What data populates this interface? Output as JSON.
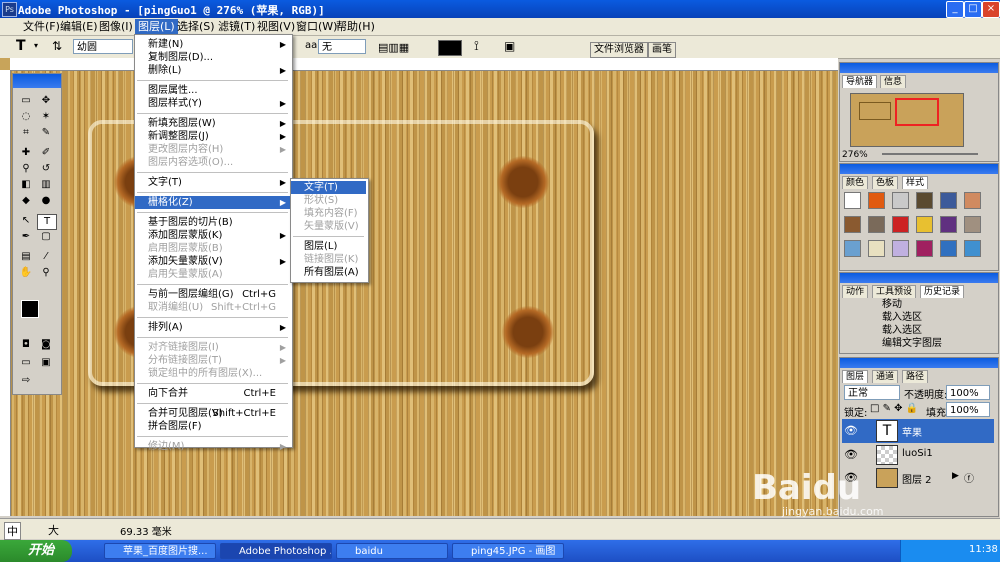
{
  "window": {
    "title": "Adobe Photoshop - [pingGuo1 @ 276% (苹果, RGB)]"
  },
  "menubar": [
    "文件(F)",
    "编辑(E)",
    "图像(I)",
    "图层(L)",
    "选择(S)",
    "滤镜(T)",
    "视图(V)",
    "窗口(W)",
    "帮助(H)"
  ],
  "options": {
    "font_family": "幼圆",
    "aa_label": "aa",
    "aa_value": "无",
    "tab_file_browser": "文件浏览器",
    "tab_brushes": "画笔"
  },
  "layer_menu": [
    {
      "label": "新建(N)",
      "arrow": true
    },
    {
      "label": "复制图层(D)..."
    },
    {
      "label": "删除(L)",
      "arrow": true
    },
    {
      "label": "图层属性..."
    },
    {
      "label": "图层样式(Y)",
      "arrow": true
    },
    {
      "label": "新填充图层(W)",
      "arrow": true
    },
    {
      "label": "新调整图层(J)",
      "arrow": true
    },
    {
      "label": "更改图层内容(H)",
      "arrow": true,
      "disabled": true
    },
    {
      "label": "图层内容选项(O)...",
      "disabled": true
    },
    {
      "label": "文字(T)",
      "arrow": true
    },
    {
      "label": "栅格化(Z)",
      "arrow": true,
      "highlight": true
    },
    {
      "label": "基于图层的切片(B)"
    },
    {
      "label": "添加图层蒙版(K)",
      "arrow": true
    },
    {
      "label": "启用图层蒙版(B)",
      "disabled": true
    },
    {
      "label": "添加矢量蒙版(V)",
      "arrow": true
    },
    {
      "label": "启用矢量蒙版(A)",
      "disabled": true
    },
    {
      "label": "与前一图层编组(G)",
      "shortcut": "Ctrl+G"
    },
    {
      "label": "取消编组(U)",
      "shortcut": "Shift+Ctrl+G",
      "disabled": true
    },
    {
      "label": "排列(A)",
      "arrow": true
    },
    {
      "label": "对齐链接图层(I)",
      "arrow": true,
      "disabled": true
    },
    {
      "label": "分布链接图层(T)",
      "arrow": true,
      "disabled": true
    },
    {
      "label": "锁定组中的所有图层(X)...",
      "disabled": true
    },
    {
      "label": "向下合并",
      "shortcut": "Ctrl+E"
    },
    {
      "label": "合并可见图层(V)",
      "shortcut": "Shift+Ctrl+E"
    },
    {
      "label": "拼合图层(F)"
    },
    {
      "label": "修边(M)",
      "arrow": true,
      "disabled": true
    }
  ],
  "rasterize_submenu": [
    {
      "label": "文字(T)",
      "highlight": true
    },
    {
      "label": "形状(S)",
      "disabled": true
    },
    {
      "label": "填充内容(F)",
      "disabled": true
    },
    {
      "label": "矢量蒙版(V)",
      "disabled": true
    },
    {
      "label": "图层(L)"
    },
    {
      "label": "链接图层(K)",
      "disabled": true
    },
    {
      "label": "所有图层(A)"
    }
  ],
  "navigator": {
    "tabs": [
      "导航器",
      "信息"
    ],
    "zoom": "276%"
  },
  "styles_panel": {
    "tabs": [
      "颜色",
      "色板",
      "样式"
    ]
  },
  "history_panel": {
    "tabs": [
      "动作",
      "工具预设",
      "历史记录"
    ],
    "items": [
      "移动",
      "载入选区",
      "载入选区",
      "编辑文字图层"
    ]
  },
  "layers_panel": {
    "tabs": [
      "图层",
      "通道",
      "路径"
    ],
    "blend_mode": "正常",
    "opacity_label": "不透明度:",
    "opacity": "100%",
    "lock_label": "锁定:",
    "fill_label": "填充:",
    "fill": "100%",
    "layers": [
      {
        "name": "苹果",
        "type": "text"
      },
      {
        "name": "luoSi1",
        "type": "normal"
      },
      {
        "name": "图层 2",
        "type": "normal"
      }
    ]
  },
  "statusbar": {
    "ime": "中",
    "ime_mode": "大",
    "measure": "69.33 毫米"
  },
  "taskbar": {
    "start": "开始",
    "tasks": [
      "苹果_百度图片搜...",
      "Adobe Photoshop ...",
      "baidu",
      "ping45.JPG - 画图"
    ],
    "clock": "11:38"
  },
  "watermark": {
    "brand": "Baidu",
    "sub": "jingyan.baidu.com"
  }
}
